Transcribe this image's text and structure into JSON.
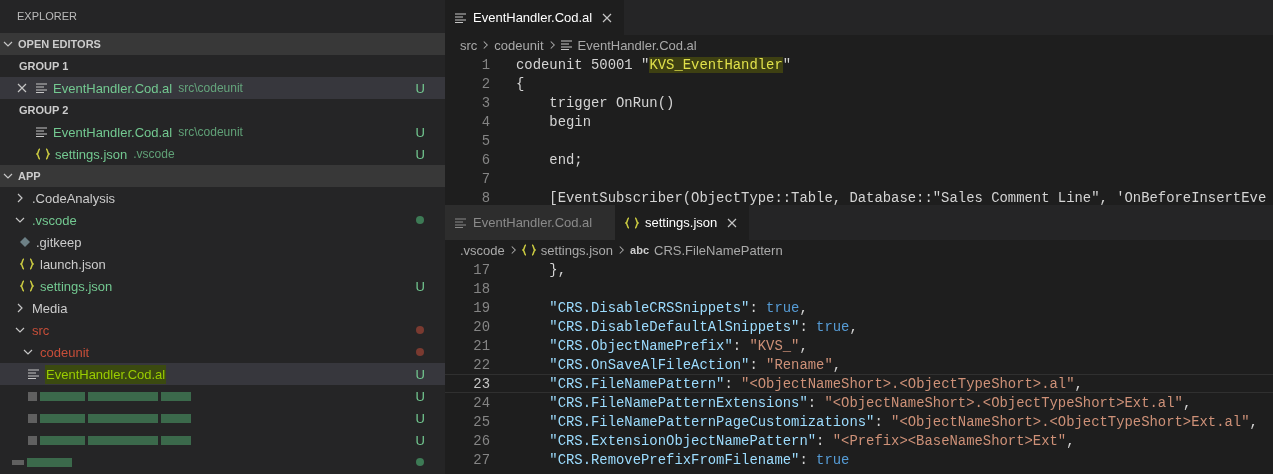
{
  "sidebar": {
    "title": "EXPLORER",
    "open_editors": {
      "title": "OPEN EDITORS",
      "expanded": true,
      "groups": [
        {
          "title": "GROUP 1",
          "items": [
            {
              "name": "EventHandler.Cod.al",
              "path": "src\\codeunit",
              "kind": "al-file",
              "badge": "U",
              "color": "#73c991",
              "selected": true
            }
          ]
        },
        {
          "title": "GROUP 2",
          "items": [
            {
              "name": "EventHandler.Cod.al",
              "path": "src\\codeunit",
              "kind": "al-file",
              "badge": "U",
              "color": "#73c991",
              "selected": false
            },
            {
              "name": "settings.json",
              "path": ".vscode",
              "kind": "json-file",
              "badge": "U",
              "color": "#73c991",
              "selected": false
            }
          ]
        }
      ]
    },
    "app": {
      "title": "APP",
      "expanded": true,
      "items": [
        {
          "kind": "folder",
          "label": ".CodeAnalysis",
          "expanded": false,
          "color": "#cccccc",
          "selected": false
        },
        {
          "kind": "folder",
          "label": ".vscode",
          "expanded": true,
          "color": "#73c991",
          "dot": {
            "color": "#3d7a55"
          },
          "selected": false,
          "children": [
            {
              "kind": "gitkeep-file",
              "label": ".gitkeep",
              "color": "#cccccc",
              "selected": false
            },
            {
              "kind": "json-file",
              "label": "launch.json",
              "color": "#cccccc",
              "selected": false
            },
            {
              "kind": "json-file",
              "label": "settings.json",
              "color": "#73c991",
              "badge": "U",
              "selected": false
            }
          ]
        },
        {
          "kind": "folder",
          "label": "Media",
          "expanded": false,
          "color": "#cccccc",
          "selected": false
        },
        {
          "kind": "folder",
          "label": "src",
          "expanded": true,
          "color": "#c74e39",
          "dot": {
            "color": "#7a3a30"
          },
          "selected": false,
          "children": [
            {
              "kind": "folder",
              "label": "codeunit",
              "expanded": true,
              "color": "#c74e39",
              "dot": {
                "color": "#7a3a30"
              },
              "selected": false,
              "children": [
                {
                  "kind": "al-file",
                  "label": "EventHandler.Cod.al",
                  "color": "#9acd00",
                  "badge": "U",
                  "selected": true,
                  "highlighted": true
                },
                {
                  "kind": "redacted-file",
                  "color": "#3f7552",
                  "badge": "U",
                  "selected": false
                },
                {
                  "kind": "redacted-file",
                  "color": "#3f7552",
                  "badge": "U",
                  "selected": false
                },
                {
                  "kind": "redacted-file",
                  "color": "#3f7552",
                  "badge": "U",
                  "selected": false
                }
              ]
            }
          ]
        },
        {
          "kind": "redacted-folder",
          "color": "#3f7552",
          "dot": {
            "color": "#3d7a55"
          },
          "selected": false
        }
      ]
    }
  },
  "editors": [
    {
      "tabs": [
        {
          "label": "EventHandler.Cod.al",
          "kind": "al-file",
          "selected": true
        }
      ],
      "breadcrumb": [
        {
          "label": "src",
          "kind": "folder"
        },
        {
          "label": "codeunit",
          "kind": "folder"
        },
        {
          "label": "EventHandler.Cod.al",
          "kind": "al-file"
        }
      ],
      "lines": [
        {
          "n": "1",
          "tokens": [
            {
              "t": "codeunit 50001 \"",
              "kind": "plain"
            },
            {
              "t": "KVS_EventHandler",
              "kind": "match"
            },
            {
              "t": "\"",
              "kind": "plain"
            }
          ]
        },
        {
          "n": "2",
          "tokens": [
            {
              "t": "{",
              "kind": "plain"
            }
          ]
        },
        {
          "n": "3",
          "tokens": [
            {
              "t": "    trigger OnRun()",
              "kind": "plain"
            }
          ]
        },
        {
          "n": "4",
          "tokens": [
            {
              "t": "    begin",
              "kind": "plain"
            }
          ]
        },
        {
          "n": "5"
        },
        {
          "n": "6",
          "tokens": [
            {
              "t": "    end;",
              "kind": "plain"
            }
          ]
        },
        {
          "n": "7"
        },
        {
          "n": "8",
          "tokens": [
            {
              "t": "    [EventSubscriber(ObjectType::Table, Database::\"Sales Comment Line\", 'OnBeforeInsertEve",
              "kind": "plain"
            }
          ]
        }
      ]
    },
    {
      "tabs": [
        {
          "label": "EventHandler.Cod.al",
          "kind": "al-file",
          "selected": false
        },
        {
          "label": "settings.json",
          "kind": "json-file",
          "selected": true
        }
      ],
      "breadcrumb": [
        {
          "label": ".vscode",
          "kind": "folder"
        },
        {
          "label": "settings.json",
          "kind": "json-file"
        },
        {
          "label": "CRS.FileNamePattern",
          "kind": "symbol",
          "symbol": "abc"
        }
      ],
      "lines": [
        {
          "n": "17",
          "current": false,
          "tokens": [
            {
              "t": "    },",
              "kind": "plain"
            }
          ]
        },
        {
          "n": "18",
          "current": false
        },
        {
          "n": "19",
          "current": false,
          "tokens": [
            {
              "t": "    \"CRS.DisableCRSSnippets\"",
              "kind": "key"
            },
            {
              "t": ": ",
              "kind": "plain"
            },
            {
              "t": "true",
              "kind": "bool"
            },
            {
              "t": ",",
              "kind": "plain"
            }
          ]
        },
        {
          "n": "20",
          "current": false,
          "tokens": [
            {
              "t": "    \"CRS.DisableDefaultAlSnippets\"",
              "kind": "key"
            },
            {
              "t": ": ",
              "kind": "plain"
            },
            {
              "t": "true",
              "kind": "bool"
            },
            {
              "t": ",",
              "kind": "plain"
            }
          ]
        },
        {
          "n": "21",
          "current": false,
          "tokens": [
            {
              "t": "    \"CRS.ObjectNamePrefix\"",
              "kind": "key"
            },
            {
              "t": ": ",
              "kind": "plain"
            },
            {
              "t": "\"KVS_\"",
              "kind": "string"
            },
            {
              "t": ",",
              "kind": "plain"
            }
          ]
        },
        {
          "n": "22",
          "current": false,
          "tokens": [
            {
              "t": "    \"CRS.OnSaveAlFileAction\"",
              "kind": "key"
            },
            {
              "t": ": ",
              "kind": "plain"
            },
            {
              "t": "\"Rename\"",
              "kind": "string"
            },
            {
              "t": ",",
              "kind": "plain"
            }
          ]
        },
        {
          "n": "23",
          "current": true,
          "tokens": [
            {
              "t": "    \"CRS.FileNamePattern\"",
              "kind": "key"
            },
            {
              "t": ": ",
              "kind": "plain"
            },
            {
              "t": "\"<ObjectNameShort>.<ObjectTypeShort>.al\"",
              "kind": "string"
            },
            {
              "t": ",",
              "kind": "plain"
            }
          ]
        },
        {
          "n": "24",
          "current": false,
          "tokens": [
            {
              "t": "    \"CRS.FileNamePatternExtensions\"",
              "kind": "key"
            },
            {
              "t": ": ",
              "kind": "plain"
            },
            {
              "t": "\"<ObjectNameShort>.<ObjectTypeShort>Ext.al\"",
              "kind": "string"
            },
            {
              "t": ",",
              "kind": "plain"
            }
          ]
        },
        {
          "n": "25",
          "current": false,
          "tokens": [
            {
              "t": "    \"CRS.FileNamePatternPageCustomizations\"",
              "kind": "key"
            },
            {
              "t": ": ",
              "kind": "plain"
            },
            {
              "t": "\"<ObjectNameShort>.<ObjectTypeShort>Ext.al\"",
              "kind": "string"
            },
            {
              "t": ",",
              "kind": "plain"
            }
          ]
        },
        {
          "n": "26",
          "current": false,
          "tokens": [
            {
              "t": "    \"CRS.ExtensionObjectNamePattern\"",
              "kind": "key"
            },
            {
              "t": ": ",
              "kind": "plain"
            },
            {
              "t": "\"<Prefix><BaseNameShort>Ext\"",
              "kind": "string"
            },
            {
              "t": ",",
              "kind": "plain"
            }
          ]
        },
        {
          "n": "27",
          "current": false,
          "tokens": [
            {
              "t": "    \"CRS.RemovePrefixFromFilename\"",
              "kind": "key"
            },
            {
              "t": ": ",
              "kind": "plain"
            },
            {
              "t": "true",
              "kind": "bool"
            }
          ]
        }
      ]
    }
  ]
}
